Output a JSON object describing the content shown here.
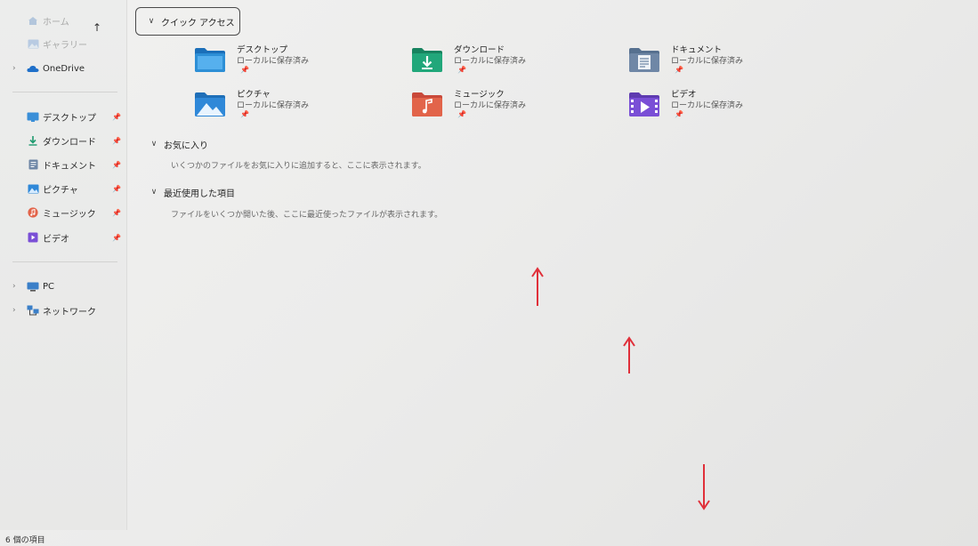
{
  "nav": {
    "home_label": "ホーム",
    "gallery_label": "ギャラリー",
    "up_glyph": "↑",
    "onedrive": {
      "label": "OneDrive",
      "icon": "cloud-icon"
    },
    "pinned": [
      {
        "label": "デスクトップ",
        "icon": "desktop-icon"
      },
      {
        "label": "ダウンロード",
        "icon": "download-icon"
      },
      {
        "label": "ドキュメント",
        "icon": "document-icon"
      },
      {
        "label": "ピクチャ",
        "icon": "pictures-icon"
      },
      {
        "label": "ミュージック",
        "icon": "music-icon"
      },
      {
        "label": "ビデオ",
        "icon": "video-icon"
      }
    ],
    "pc": {
      "label": "PC",
      "icon": "pc-icon"
    },
    "network": {
      "label": "ネットワーク",
      "icon": "network-icon"
    },
    "pin_glyph": "📌",
    "expand_glyph": "›"
  },
  "quick_access": {
    "title": "クイック アクセス",
    "chevron": "∨",
    "items": [
      {
        "name": "デスクトップ",
        "status": "ローカルに保存済み",
        "color": "#2d8fd6",
        "icon": "desktop-folder-icon"
      },
      {
        "name": "ダウンロード",
        "status": "ローカルに保存済み",
        "color": "#21a77a",
        "icon": "downloads-folder-icon"
      },
      {
        "name": "ドキュメント",
        "status": "ローカルに保存済み",
        "color": "#6f87a6",
        "icon": "documents-folder-icon"
      },
      {
        "name": "ピクチャ",
        "status": "ローカルに保存済み",
        "color": "#2f88d8",
        "icon": "pictures-folder-icon"
      },
      {
        "name": "ミュージック",
        "status": "ローカルに保存済み",
        "color": "#e2644a",
        "icon": "music-folder-icon"
      },
      {
        "name": "ビデオ",
        "status": "ローカルに保存済み",
        "color": "#7a4fd6",
        "icon": "videos-folder-icon"
      }
    ]
  },
  "favorites": {
    "title": "お気に入り",
    "chevron": "∨",
    "desc": "いくつかのファイルをお気に入りに追加すると、ここに表示されます。"
  },
  "recent": {
    "title": "最近使用した項目",
    "chevron": "∨",
    "desc": "ファイルをいくつか開いた後、ここに最近使ったファイルが表示されます。"
  },
  "status_bar": {
    "count": "6 個の項目"
  },
  "annotations": {
    "arrow_color": "#e0303a"
  }
}
